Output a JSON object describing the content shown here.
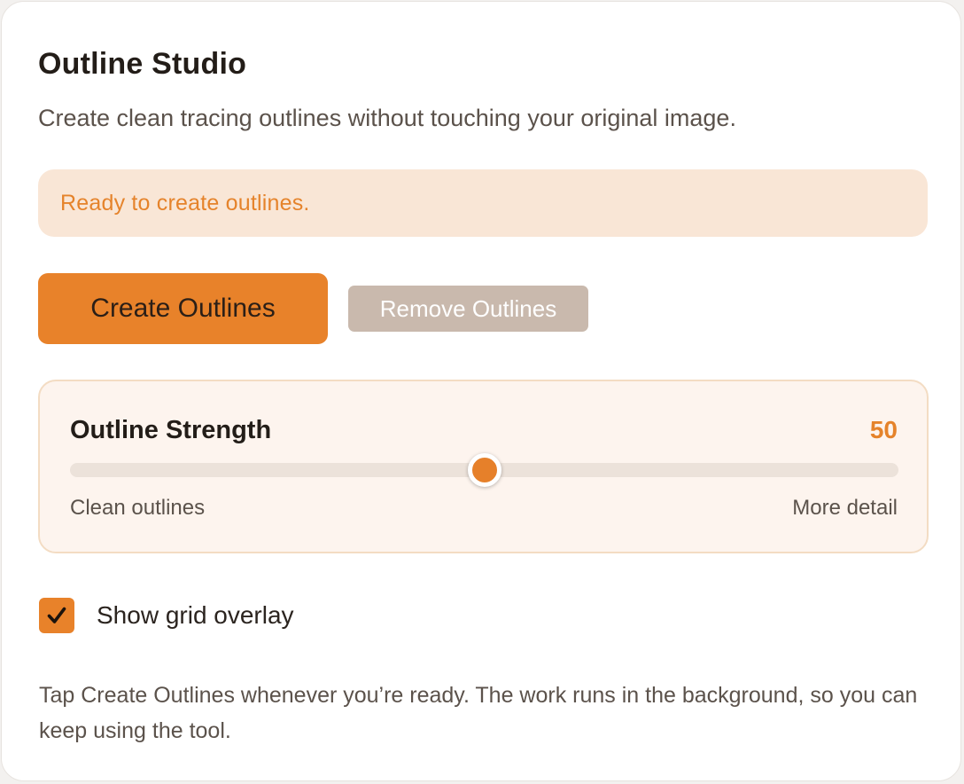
{
  "app": {
    "title": "Outline Studio",
    "subtitle": "Create clean tracing outlines without touching your original image."
  },
  "status": {
    "message": "Ready to create outlines."
  },
  "actions": {
    "create_label": "Create Outlines",
    "remove_label": "Remove Outlines",
    "remove_disabled": true
  },
  "strength": {
    "label": "Outline Strength",
    "value": "50",
    "min": 0,
    "max": 100,
    "current": 50,
    "min_label": "Clean outlines",
    "max_label": "More detail"
  },
  "grid_overlay": {
    "label": "Show grid overlay",
    "checked": true
  },
  "footer": {
    "note": "Tap Create Outlines whenever you’re ready. The work runs in the background, so you can keep using the tool."
  },
  "colors": {
    "accent": "#e8822a",
    "accent_text": "#e5832b",
    "status_bg": "#f9e6d6",
    "panel_bg": "#fdf4ee",
    "panel_border": "#f3dcc3",
    "disabled_button": "#c9b9ad"
  },
  "icons": {
    "checkbox": "checkmark-icon"
  }
}
